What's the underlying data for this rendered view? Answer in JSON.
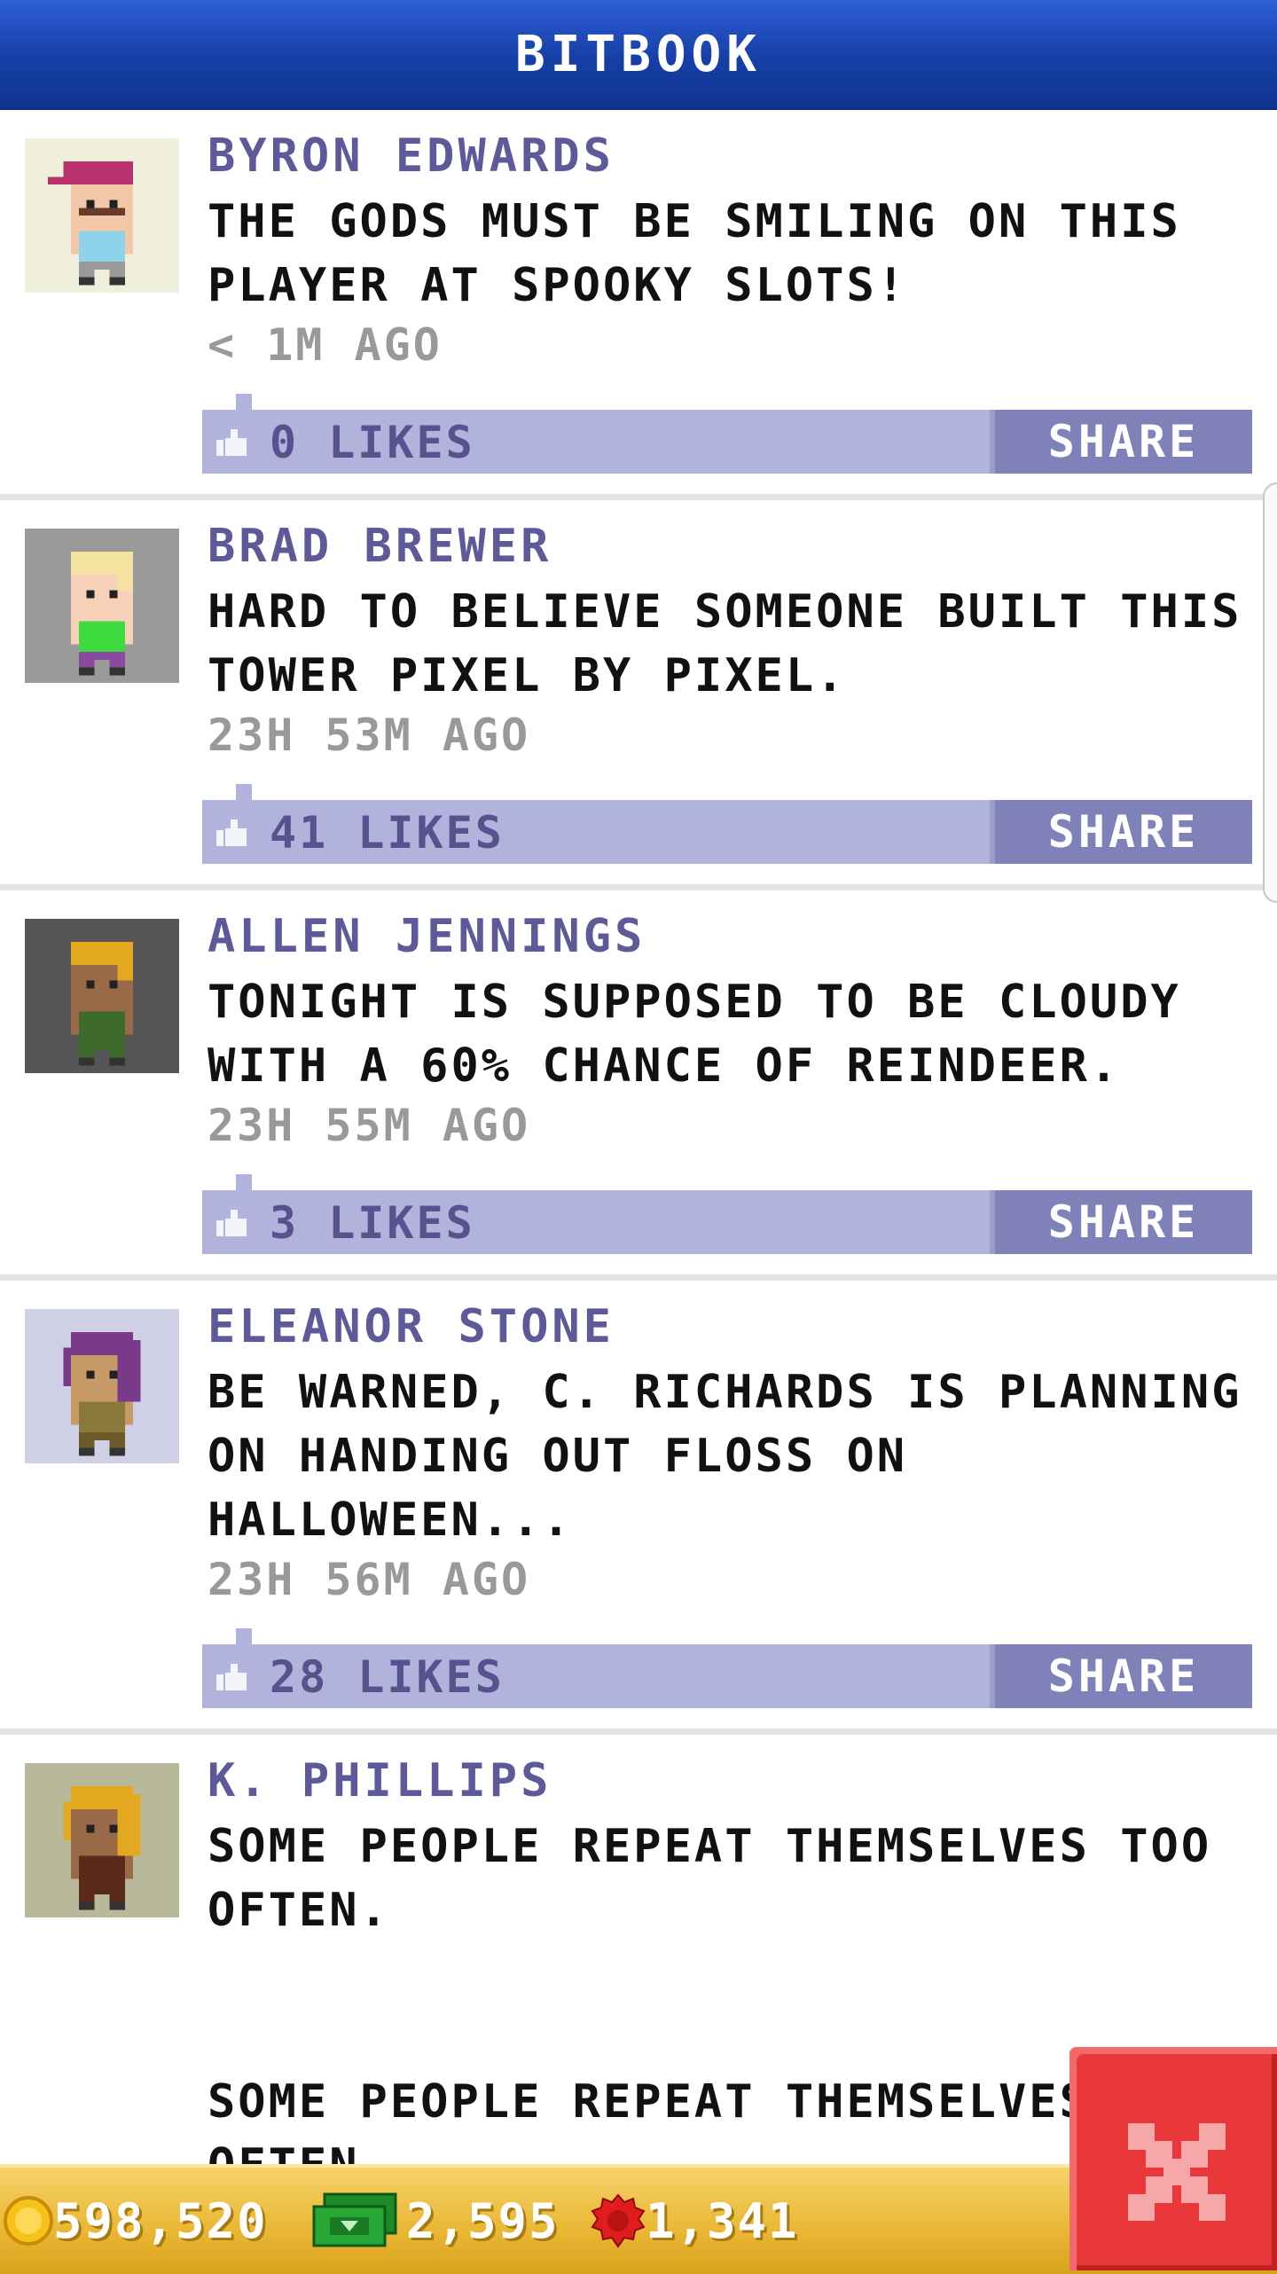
{
  "header": {
    "title": "BITBOOK"
  },
  "posts": [
    {
      "author": "BYRON EDWARDS",
      "message": "THE GODS MUST BE SMILING ON THIS PLAYER AT SPOOKY SLOTS!",
      "time": "< 1M AGO",
      "likes": "0 LIKES",
      "share": "SHARE",
      "avatar": {
        "bg": "#efefdc",
        "hair": "#b8326e",
        "skin": "#f2c8a8",
        "shirt": "#8fd3ea",
        "pants": "#9a9a9a",
        "style": "cap"
      }
    },
    {
      "author": "BRAD BREWER",
      "message": "HARD TO BELIEVE SOMEONE BUILT THIS TOWER PIXEL BY PIXEL.",
      "time": "23H 53M AGO",
      "likes": "41 LIKES",
      "share": "SHARE",
      "avatar": {
        "bg": "#9a9a9a",
        "hair": "#f4e2a0",
        "skin": "#f7d2b8",
        "shirt": "#3ddb3d",
        "pants": "#8a4aa0",
        "style": "short"
      }
    },
    {
      "author": "ALLEN JENNINGS",
      "message": "TONIGHT IS SUPPOSED TO BE CLOUDY WITH A 60% CHANCE OF REINDEER.",
      "time": "23H 55M AGO",
      "likes": "3 LIKES",
      "share": "SHARE",
      "avatar": {
        "bg": "#555555",
        "hair": "#e2a820",
        "skin": "#9a6a48",
        "shirt": "#3e6a2e",
        "pants": "#3e6a2e",
        "style": "short"
      }
    },
    {
      "author": "ELEANOR STONE",
      "message": "BE WARNED, C. RICHARDS IS PLANNING ON HANDING OUT FLOSS ON HALLOWEEN...",
      "time": "23H 56M AGO",
      "likes": "28 LIKES",
      "share": "SHARE",
      "avatar": {
        "bg": "#cfd0e6",
        "hair": "#7a3a8a",
        "skin": "#c89a68",
        "shirt": "#8a7a3a",
        "pants": "#6a5a2a",
        "style": "long"
      }
    },
    {
      "author": "K. PHILLIPS",
      "message": "SOME PEOPLE REPEAT THEMSELVES TOO OFTEN.\n\n\nSOME PEOPLE REPEAT THEMSELVES TOO OFTEN.",
      "avatar": {
        "bg": "#b8b89a",
        "hair": "#e2a820",
        "skin": "#9a6a48",
        "shirt": "#5a2a1a",
        "pants": "#5a2a1a",
        "style": "long"
      }
    }
  ],
  "currency": {
    "coins": "598,520",
    "cash": "2,595",
    "tickets": "1,341"
  },
  "icons": {
    "coin": "coin-icon",
    "cash": "cash-icon",
    "ticket": "ticket-icon",
    "like": "thumbs-up-icon",
    "close": "close-icon"
  },
  "colors": {
    "header": "#1a46b0",
    "author": "#5e5a9a",
    "like_bar": "#b1b3dc",
    "share_button": "#7f82b8",
    "currency_bar": "#e9b733",
    "close_button": "#e8383a"
  }
}
